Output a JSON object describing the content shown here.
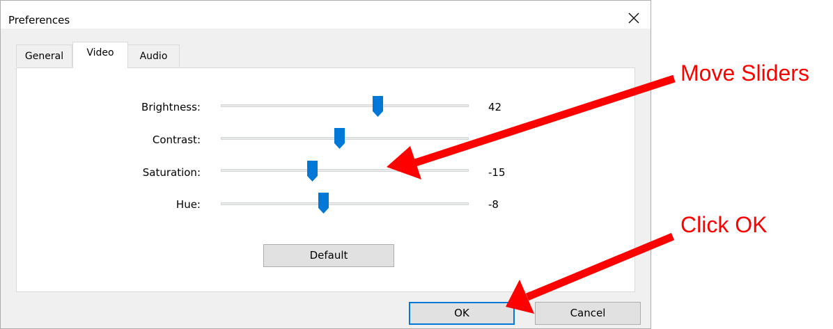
{
  "dialog": {
    "title": "Preferences",
    "close_icon": "close-icon"
  },
  "tabs": [
    {
      "label": "General",
      "selected": false
    },
    {
      "label": "Video",
      "selected": true
    },
    {
      "label": "Audio",
      "selected": false
    }
  ],
  "sliders": [
    {
      "label": "Brightness:",
      "value": "42",
      "level": 0.7
    },
    {
      "label": "Contrast:",
      "value": "",
      "level": 0.54
    },
    {
      "label": "Saturation:",
      "value": "-15",
      "level": 0.43
    },
    {
      "label": "Hue:",
      "value": "-8",
      "level": 0.47
    }
  ],
  "buttons": {
    "default_label": "Default",
    "ok_label": "OK",
    "cancel_label": "Cancel"
  },
  "annotations": {
    "move_sliders": "Move Sliders",
    "click_ok": "Click OK",
    "color": "#ff0000"
  },
  "colors": {
    "accent": "#0078d7",
    "button_face": "#e1e1e1",
    "dialog_bg": "#f0f0f0"
  }
}
